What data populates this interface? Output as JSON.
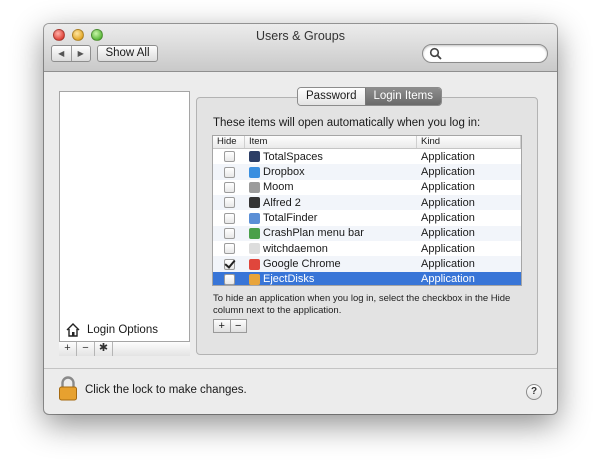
{
  "window": {
    "title": "Users & Groups"
  },
  "toolbar": {
    "back_icon": "back-arrow-icon",
    "forward_icon": "forward-arrow-icon",
    "back_glyph": "◀",
    "forward_glyph": "▶",
    "show_all_label": "Show All",
    "search_placeholder": ""
  },
  "tabs": [
    {
      "label": "Password",
      "selected": false
    },
    {
      "label": "Login Items",
      "selected": true
    }
  ],
  "intro_text": "These items will open automatically when you log in:",
  "table": {
    "headers": {
      "hide": "Hide",
      "item": "Item",
      "kind": "Kind"
    },
    "rows": [
      {
        "hide": false,
        "name": "TotalSpaces",
        "kind": "Application",
        "icon": "totalspaces-icon",
        "color": "#2c3e66"
      },
      {
        "hide": false,
        "name": "Dropbox",
        "kind": "Application",
        "icon": "dropbox-icon",
        "color": "#3a8fe0"
      },
      {
        "hide": false,
        "name": "Moom",
        "kind": "Application",
        "icon": "moom-icon",
        "color": "#9b9b9b"
      },
      {
        "hide": false,
        "name": "Alfred 2",
        "kind": "Application",
        "icon": "alfred-icon",
        "color": "#333333"
      },
      {
        "hide": false,
        "name": "TotalFinder",
        "kind": "Application",
        "icon": "totalfinder-icon",
        "color": "#5b8fd6"
      },
      {
        "hide": false,
        "name": "CrashPlan menu bar",
        "kind": "Application",
        "icon": "crashplan-icon",
        "color": "#4aa04a"
      },
      {
        "hide": false,
        "name": "witchdaemon",
        "kind": "Application",
        "icon": "witch-icon",
        "color": "#dddddd"
      },
      {
        "hide": true,
        "name": "Google Chrome",
        "kind": "Application",
        "icon": "chrome-icon",
        "color": "#e0463c"
      },
      {
        "hide": false,
        "name": "EjectDisks",
        "kind": "Application",
        "icon": "ejectdisks-icon",
        "color": "#e8a43a",
        "selected": true
      }
    ]
  },
  "hint_text": "To hide an application when you log in, select the checkbox in the Hide column next to the application.",
  "item_buttons": {
    "add": "+",
    "remove": "−"
  },
  "sidebar": {
    "login_options_label": "Login Options",
    "add": "+",
    "remove": "−",
    "gear": "✱"
  },
  "footer": {
    "lock_text": "Click the lock to make changes.",
    "help_label": "?"
  },
  "colors": {
    "selection": "#3875d7",
    "window_bg": "#ececec"
  }
}
